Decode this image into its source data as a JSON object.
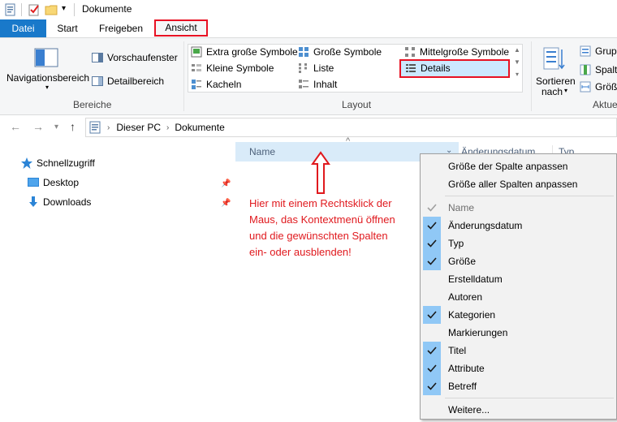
{
  "window": {
    "title": "Dokumente"
  },
  "tabs": [
    {
      "label": "Datei"
    },
    {
      "label": "Start"
    },
    {
      "label": "Freigeben"
    },
    {
      "label": "Ansicht"
    }
  ],
  "ribbon": {
    "bereiche": {
      "label": "Bereiche",
      "navigationsbereich": "Navigationsbereich",
      "vorschaufenster": "Vorschaufenster",
      "detailbereich": "Detailbereich"
    },
    "layout": {
      "label": "Layout",
      "items": [
        "Extra große Symbole",
        "Große Symbole",
        "Mittelgroße Symbole",
        "Kleine Symbole",
        "Liste",
        "Details",
        "Kacheln",
        "Inhalt"
      ]
    },
    "aktuelle_ansicht": {
      "label": "Aktue",
      "sortieren": "Sortieren",
      "nach": "nach",
      "items": [
        "Grupp",
        "Spalte",
        "Größe"
      ]
    }
  },
  "address": {
    "crumbs": [
      "Dieser PC",
      "Dokumente"
    ]
  },
  "navpane": {
    "items": [
      {
        "label": "Schnellzugriff"
      },
      {
        "label": "Desktop"
      },
      {
        "label": "Downloads"
      }
    ]
  },
  "columns": {
    "name": "Name",
    "aenderungsdatum": "Änderungsdatum",
    "typ": "Typ"
  },
  "annotation": {
    "text_lines": [
      "Hier mit einem Rechtsklick der",
      "Maus, das Kontextmenü öffnen",
      "und die gewünschten Spalten",
      "ein- oder ausblenden!"
    ]
  },
  "context_menu": {
    "top_items": [
      "Größe der Spalte anpassen",
      "Größe aller Spalten anpassen"
    ],
    "columns": [
      {
        "label": "Name",
        "checked": true,
        "disabled": true
      },
      {
        "label": "Änderungsdatum",
        "checked": true
      },
      {
        "label": "Typ",
        "checked": true
      },
      {
        "label": "Größe",
        "checked": true
      },
      {
        "label": "Erstelldatum",
        "checked": false
      },
      {
        "label": "Autoren",
        "checked": false
      },
      {
        "label": "Kategorien",
        "checked": true
      },
      {
        "label": "Markierungen",
        "checked": false
      },
      {
        "label": "Titel",
        "checked": true
      },
      {
        "label": "Attribute",
        "checked": true
      },
      {
        "label": "Betreff",
        "checked": true
      }
    ],
    "more": "Weitere..."
  },
  "colors": {
    "accent": "#1979ca",
    "highlight_red": "#e81123",
    "check_bg": "#90c8f6",
    "header_bg": "#d9ebf9"
  }
}
